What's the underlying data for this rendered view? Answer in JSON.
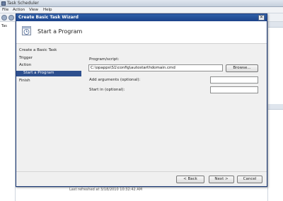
{
  "app": {
    "title": "Task Scheduler",
    "menu": [
      "File",
      "Action",
      "View",
      "Help"
    ],
    "tree_item": "Tas",
    "status_text": "Last refreshed at 3/18/2010 10:32:42 AM"
  },
  "wizard": {
    "title": "Create Basic Task Wizard",
    "close_glyph": "✕",
    "heading": "Start a Program",
    "steps": [
      {
        "label": "Create a Basic Task",
        "active": false
      },
      {
        "label": "Trigger",
        "active": false
      },
      {
        "label": "Action",
        "active": false
      },
      {
        "label": "Start a Program",
        "active": true
      },
      {
        "label": "Finish",
        "active": false
      }
    ],
    "program_label": "Program/script:",
    "program_value": "C:\\opapps\\S1\\config\\autostarthdomain.cmd",
    "browse_label": "Browse...",
    "arguments_label": "Add arguments (optional):",
    "arguments_value": "",
    "start_in_label": "Start in (optional):",
    "start_in_value": "",
    "back_label": "< Back",
    "next_label": "Next >",
    "cancel_label": "Cancel"
  },
  "icons": {
    "app": "task-scheduler-icon",
    "wizard": "clock-calendar-icon"
  }
}
